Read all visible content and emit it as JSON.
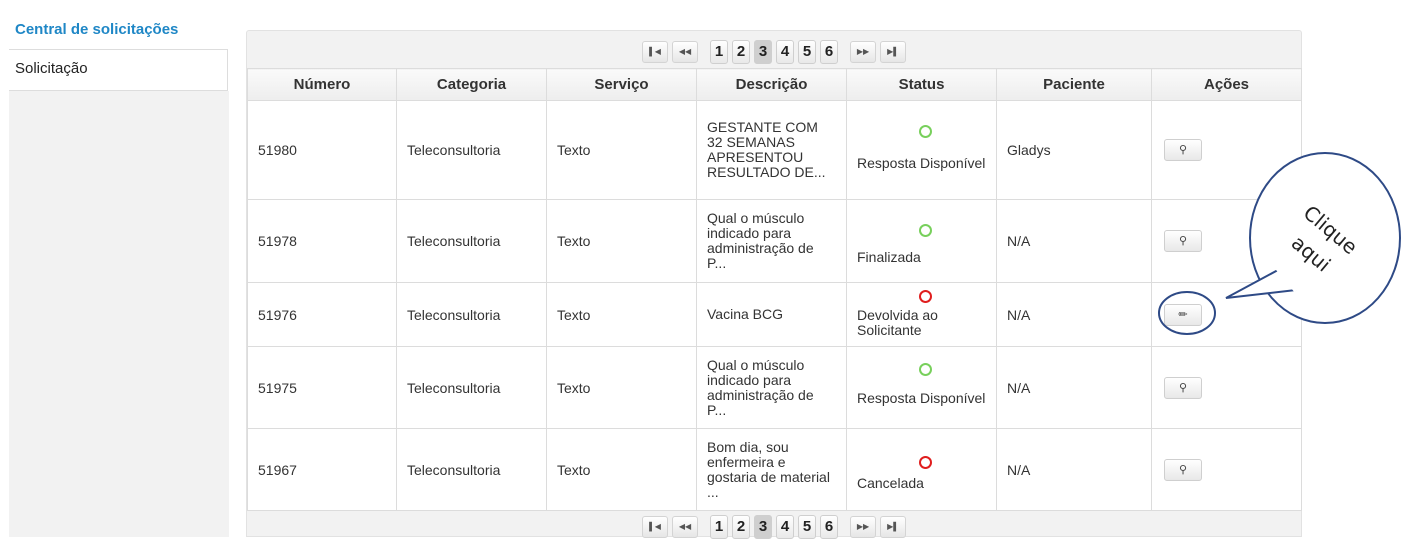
{
  "sidebar": {
    "items": [
      {
        "label": "Central de solicitações",
        "active": true
      },
      {
        "label": "Solicitação",
        "active": false
      }
    ]
  },
  "pagination": {
    "first_icon": "first-page-icon",
    "prev_icon": "prev-page-icon",
    "next_icon": "next-page-icon",
    "last_icon": "last-page-icon",
    "pages": [
      "1",
      "2",
      "3",
      "4",
      "5",
      "6"
    ],
    "current": "3"
  },
  "table": {
    "columns": [
      "Número",
      "Categoria",
      "Serviço",
      "Descrição",
      "Status",
      "Paciente",
      "Ações"
    ],
    "rows": [
      {
        "numero": "51980",
        "categoria": "Teleconsultoria",
        "servico": "Texto",
        "descricao": "GESTANTE COM 32 SEMANAS APRESENTOU RESULTADO DE...",
        "status": "Resposta Disponível",
        "status_color": "green",
        "paciente": "Gladys",
        "acao": "view",
        "acao_icon": "magnifier-icon"
      },
      {
        "numero": "51978",
        "categoria": "Teleconsultoria",
        "servico": "Texto",
        "descricao": "Qual o músculo indicado para administração de P...",
        "status": "Finalizada",
        "status_color": "green",
        "paciente": "N/A",
        "acao": "view",
        "acao_icon": "magnifier-icon"
      },
      {
        "numero": "51976",
        "categoria": "Teleconsultoria",
        "servico": "Texto",
        "descricao": "Vacina BCG",
        "status": "Devolvida ao Solicitante",
        "status_color": "red",
        "paciente": "N/A",
        "acao": "edit",
        "acao_icon": "pencil-icon"
      },
      {
        "numero": "51975",
        "categoria": "Teleconsultoria",
        "servico": "Texto",
        "descricao": "Qual o músculo indicado para administração de P...",
        "status": "Resposta Disponível",
        "status_color": "green",
        "paciente": "N/A",
        "acao": "view",
        "acao_icon": "magnifier-icon"
      },
      {
        "numero": "51967",
        "categoria": "Teleconsultoria",
        "servico": "Texto",
        "descricao": "Bom dia, sou enfermeira e gostaria de material ...",
        "status": "Cancelada",
        "status_color": "red",
        "paciente": "N/A",
        "acao": "view",
        "acao_icon": "magnifier-icon"
      }
    ]
  },
  "callout": {
    "line1": "Clique",
    "line2": "aqui"
  },
  "colors": {
    "accent": "#1f87c6",
    "status_green": "#78d05c",
    "status_red": "#e01e1e",
    "callout_stroke": "#2e4a86"
  }
}
